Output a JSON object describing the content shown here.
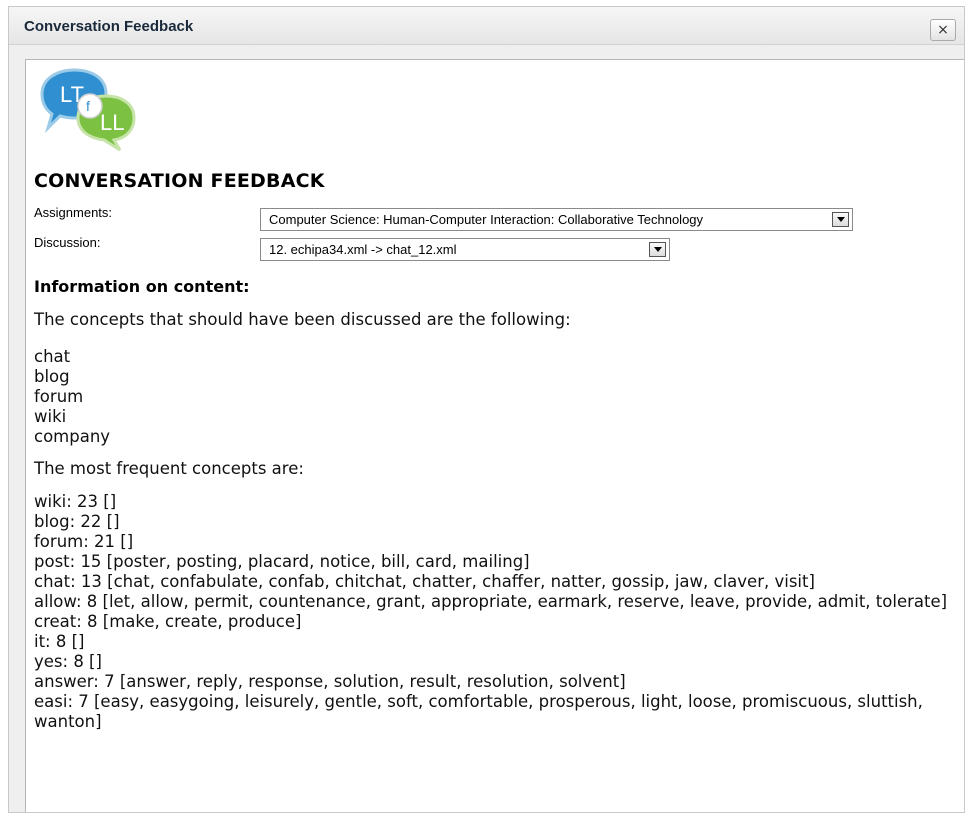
{
  "dialog": {
    "title": "Conversation Feedback",
    "close_label": "×"
  },
  "logo": {
    "letters": "LTfLL"
  },
  "page": {
    "heading": "CONVERSATION FEEDBACK",
    "assignments_label": "Assignments:",
    "assignments_value": "Computer Science: Human-Computer Interaction: Collaborative Technology",
    "discussion_label": "Discussion:",
    "discussion_value": "12. echipa34.xml -> chat_12.xml"
  },
  "content": {
    "info_heading": "Information on content:",
    "should_text": "The concepts that should have been discussed are the following:",
    "concepts": [
      "chat",
      "blog",
      "forum",
      "wiki",
      "company"
    ],
    "frequent_text": "The most frequent concepts are:",
    "frequent": [
      "wiki: 23 []",
      "blog: 22 []",
      "forum: 21 []",
      "post: 15 [poster, posting, placard, notice, bill, card, mailing]",
      "chat: 13 [chat, confabulate, confab, chitchat, chatter, chaffer, natter, gossip, jaw, claver, visit]",
      "allow: 8 [let, allow, permit, countenance, grant, appropriate, earmark, reserve, leave, provide, admit, tolerate]",
      "creat: 8 [make, create, produce]",
      "it: 8 []",
      "yes: 8 []",
      "answer: 7 [answer, reply, response, solution, result, resolution, solvent]",
      "easi: 7 [easy, easygoing, leisurely, gentle, soft, comfortable, prosperous, light, loose, promiscuous, sluttish, wanton]"
    ]
  },
  "colors": {
    "logo_blue": "#2f8fd0",
    "logo_green": "#7cc142",
    "titlebar": "#e9e9e9"
  }
}
